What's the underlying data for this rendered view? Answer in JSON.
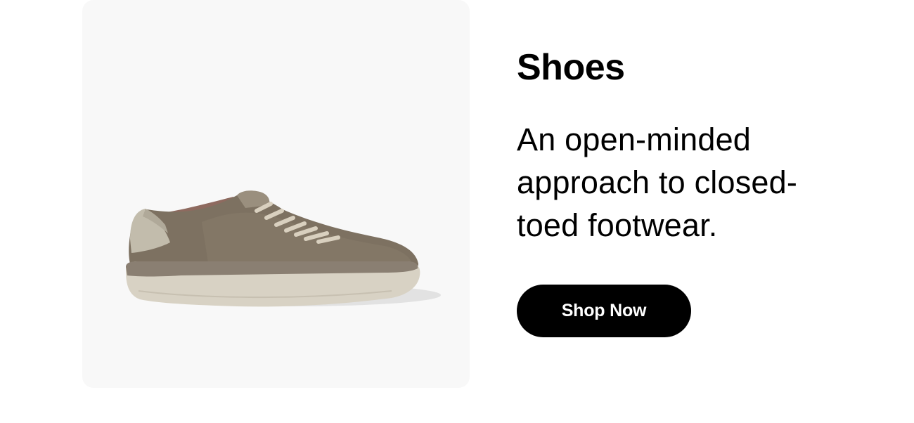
{
  "product_image": {
    "icon": "sneaker-shoe-image",
    "colors": {
      "card_background": "#f8f8f8",
      "upper": "#7d7161",
      "sole": "#d8d2c4",
      "sole_stripe": "#8a7f72",
      "heel": "#c2bcac",
      "laces": "#d9d0bf"
    }
  },
  "category": {
    "title": "Shoes",
    "description_lines": [
      "An open-minded",
      "approach to closed-",
      "toed footwear."
    ]
  },
  "cta": {
    "label": "Shop Now",
    "background": "#000000",
    "text_color": "#ffffff"
  }
}
